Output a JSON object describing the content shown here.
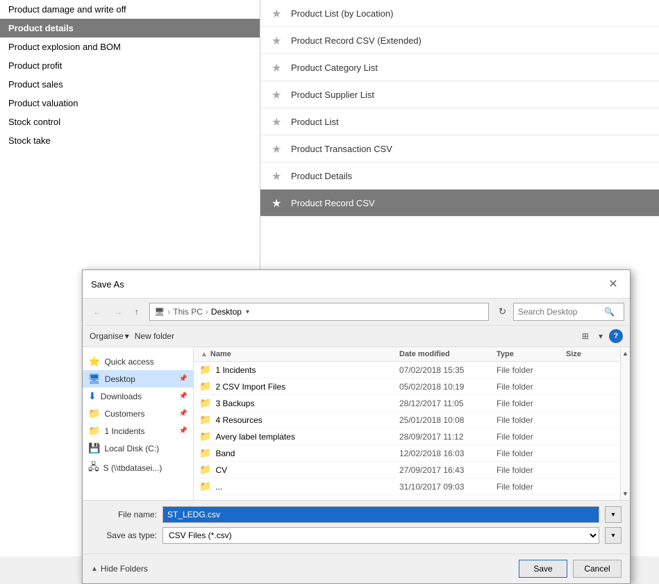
{
  "sidebar": {
    "items": [
      {
        "label": "Product damage and write off",
        "active": false
      },
      {
        "label": "Product details",
        "active": true
      },
      {
        "label": "Product explosion and BOM",
        "active": false
      },
      {
        "label": "Product profit",
        "active": false
      },
      {
        "label": "Product sales",
        "active": false
      },
      {
        "label": "Product valuation",
        "active": false
      },
      {
        "label": "Stock control",
        "active": false
      },
      {
        "label": "Stock take",
        "active": false
      }
    ]
  },
  "reports": [
    {
      "label": "Product List (by Location)",
      "selected": false
    },
    {
      "label": "Product Record CSV (Extended)",
      "selected": false
    },
    {
      "label": "Product Category List",
      "selected": false
    },
    {
      "label": "Product Supplier List",
      "selected": false
    },
    {
      "label": "Product List",
      "selected": false
    },
    {
      "label": "Product Transaction CSV",
      "selected": false
    },
    {
      "label": "Product Details",
      "selected": false
    },
    {
      "label": "Product Record CSV",
      "selected": true
    }
  ],
  "dialog": {
    "title": "Save As",
    "toolbar": {
      "back_label": "←",
      "forward_label": "→",
      "up_label": "↑",
      "address_pc": "This PC",
      "address_sep": "›",
      "address_location": "Desktop",
      "refresh_label": "↻",
      "search_placeholder": "Search Desktop"
    },
    "organise": {
      "organise_label": "Organise",
      "new_folder_label": "New folder",
      "view_icon": "⊞",
      "help_label": "?"
    },
    "nav_panel": {
      "items": [
        {
          "label": "Quick access",
          "icon": "⭐",
          "type": "header"
        },
        {
          "label": "Desktop",
          "icon": "🖥",
          "type": "item",
          "selected": true,
          "pinned": true
        },
        {
          "label": "Downloads",
          "icon": "⬇",
          "type": "item",
          "pinned": true
        },
        {
          "label": "Customers",
          "icon": "📁",
          "type": "item",
          "pinned": true
        },
        {
          "label": "1 Incidents",
          "icon": "📌",
          "type": "item",
          "pinned": true
        },
        {
          "label": "Local Disk (C:)",
          "icon": "💾",
          "type": "item"
        },
        {
          "label": "S (\\\\tbdatasei...)",
          "icon": "🖧",
          "type": "item"
        }
      ]
    },
    "file_list": {
      "columns": [
        "Name",
        "Date modified",
        "Type",
        "Size"
      ],
      "files": [
        {
          "name": "1 Incidents",
          "date": "07/02/2018 15:35",
          "type": "File folder",
          "size": ""
        },
        {
          "name": "2 CSV Import Files",
          "date": "05/02/2018 10:19",
          "type": "File folder",
          "size": ""
        },
        {
          "name": "3 Backups",
          "date": "28/12/2017 11:05",
          "type": "File folder",
          "size": ""
        },
        {
          "name": "4 Resources",
          "date": "25/01/2018 10:08",
          "type": "File folder",
          "size": ""
        },
        {
          "name": "Avery label templates",
          "date": "28/09/2017 11:12",
          "type": "File folder",
          "size": ""
        },
        {
          "name": "Band",
          "date": "12/02/2018 16:03",
          "type": "File folder",
          "size": ""
        },
        {
          "name": "CV",
          "date": "27/09/2017 16:43",
          "type": "File folder",
          "size": ""
        },
        {
          "name": "...",
          "date": "31/10/2017 09:03",
          "type": "File folder",
          "size": ""
        }
      ]
    },
    "filename": {
      "label": "File name:",
      "value": "ST_LEDG.csv",
      "type_label": "Save as type:",
      "type_value": "CSV Files (*.csv)"
    },
    "actions": {
      "hide_folders": "Hide Folders",
      "save": "Save",
      "cancel": "Cancel"
    }
  }
}
